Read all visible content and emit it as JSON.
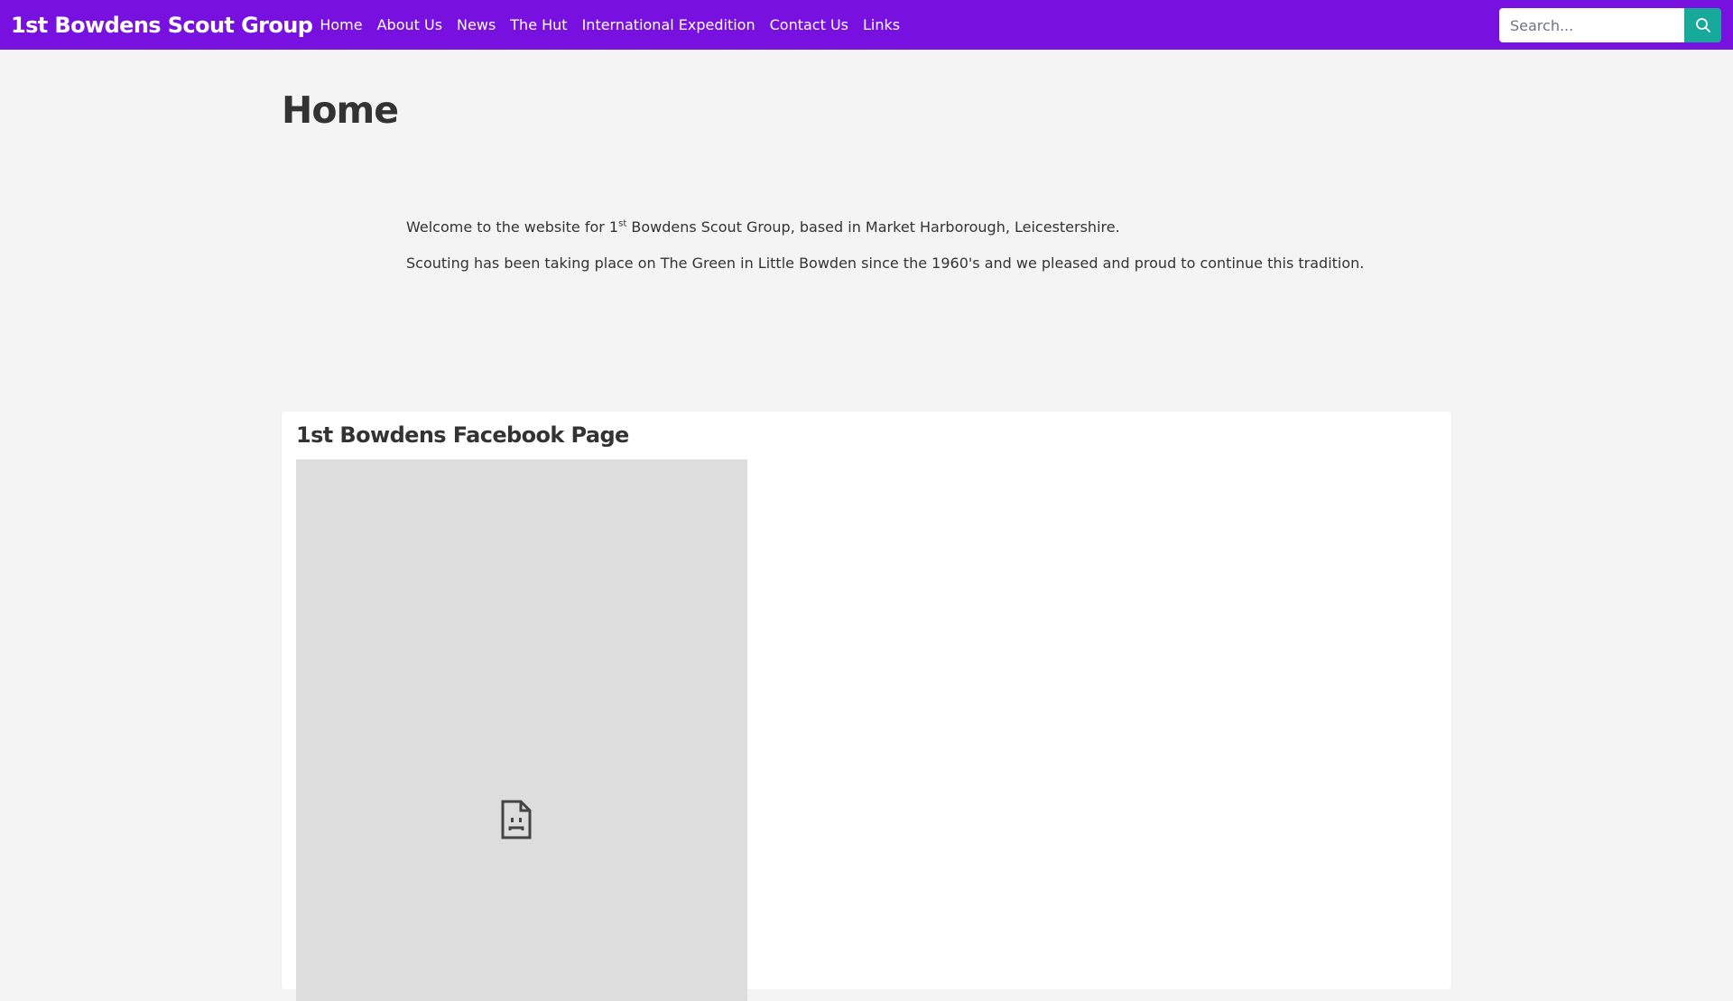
{
  "navbar": {
    "brand": "1st Bowdens Scout Group",
    "links": [
      "Home",
      "About Us",
      "News",
      "The Hut",
      "International Expedition",
      "Contact Us",
      "Links"
    ],
    "search": {
      "placeholder": "Search...",
      "button_icon": "search-icon"
    },
    "colors": {
      "background": "#7811e0",
      "search_button": "#17a99a"
    }
  },
  "main": {
    "title": "Home",
    "intro": {
      "p1_before_sup": "Welcome to the website for 1",
      "p1_sup": "st",
      "p1_after_sup": " Bowdens Scout Group, based in Market Harborough, Leicestershire.",
      "p2": "Scouting has been taking place on The Green in Little Bowden since the 1960's and we pleased and proud to continue this tradition."
    }
  },
  "facebook_card": {
    "title": "1st Bowdens Facebook Page",
    "frame_icon": "sad-document-icon"
  }
}
